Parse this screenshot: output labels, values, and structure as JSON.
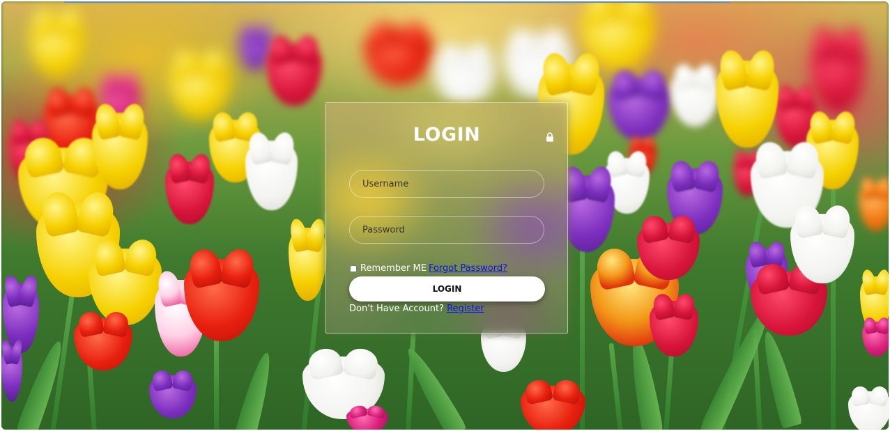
{
  "login_form": {
    "title": "LOGIN",
    "icon": "lock-icon",
    "username_placeholder": "Username",
    "password_placeholder": "Password",
    "remember_label": "Remember ME",
    "forgot_link": "Forgot Password?",
    "login_button": "LOGIN",
    "no_account_text": "Don't Have Account?",
    "register_link": "Register"
  },
  "colors": {
    "accent_link": "#1010ee",
    "card_border": "rgba(255,255,255,0.55)",
    "button_bg": "#ffffff"
  }
}
